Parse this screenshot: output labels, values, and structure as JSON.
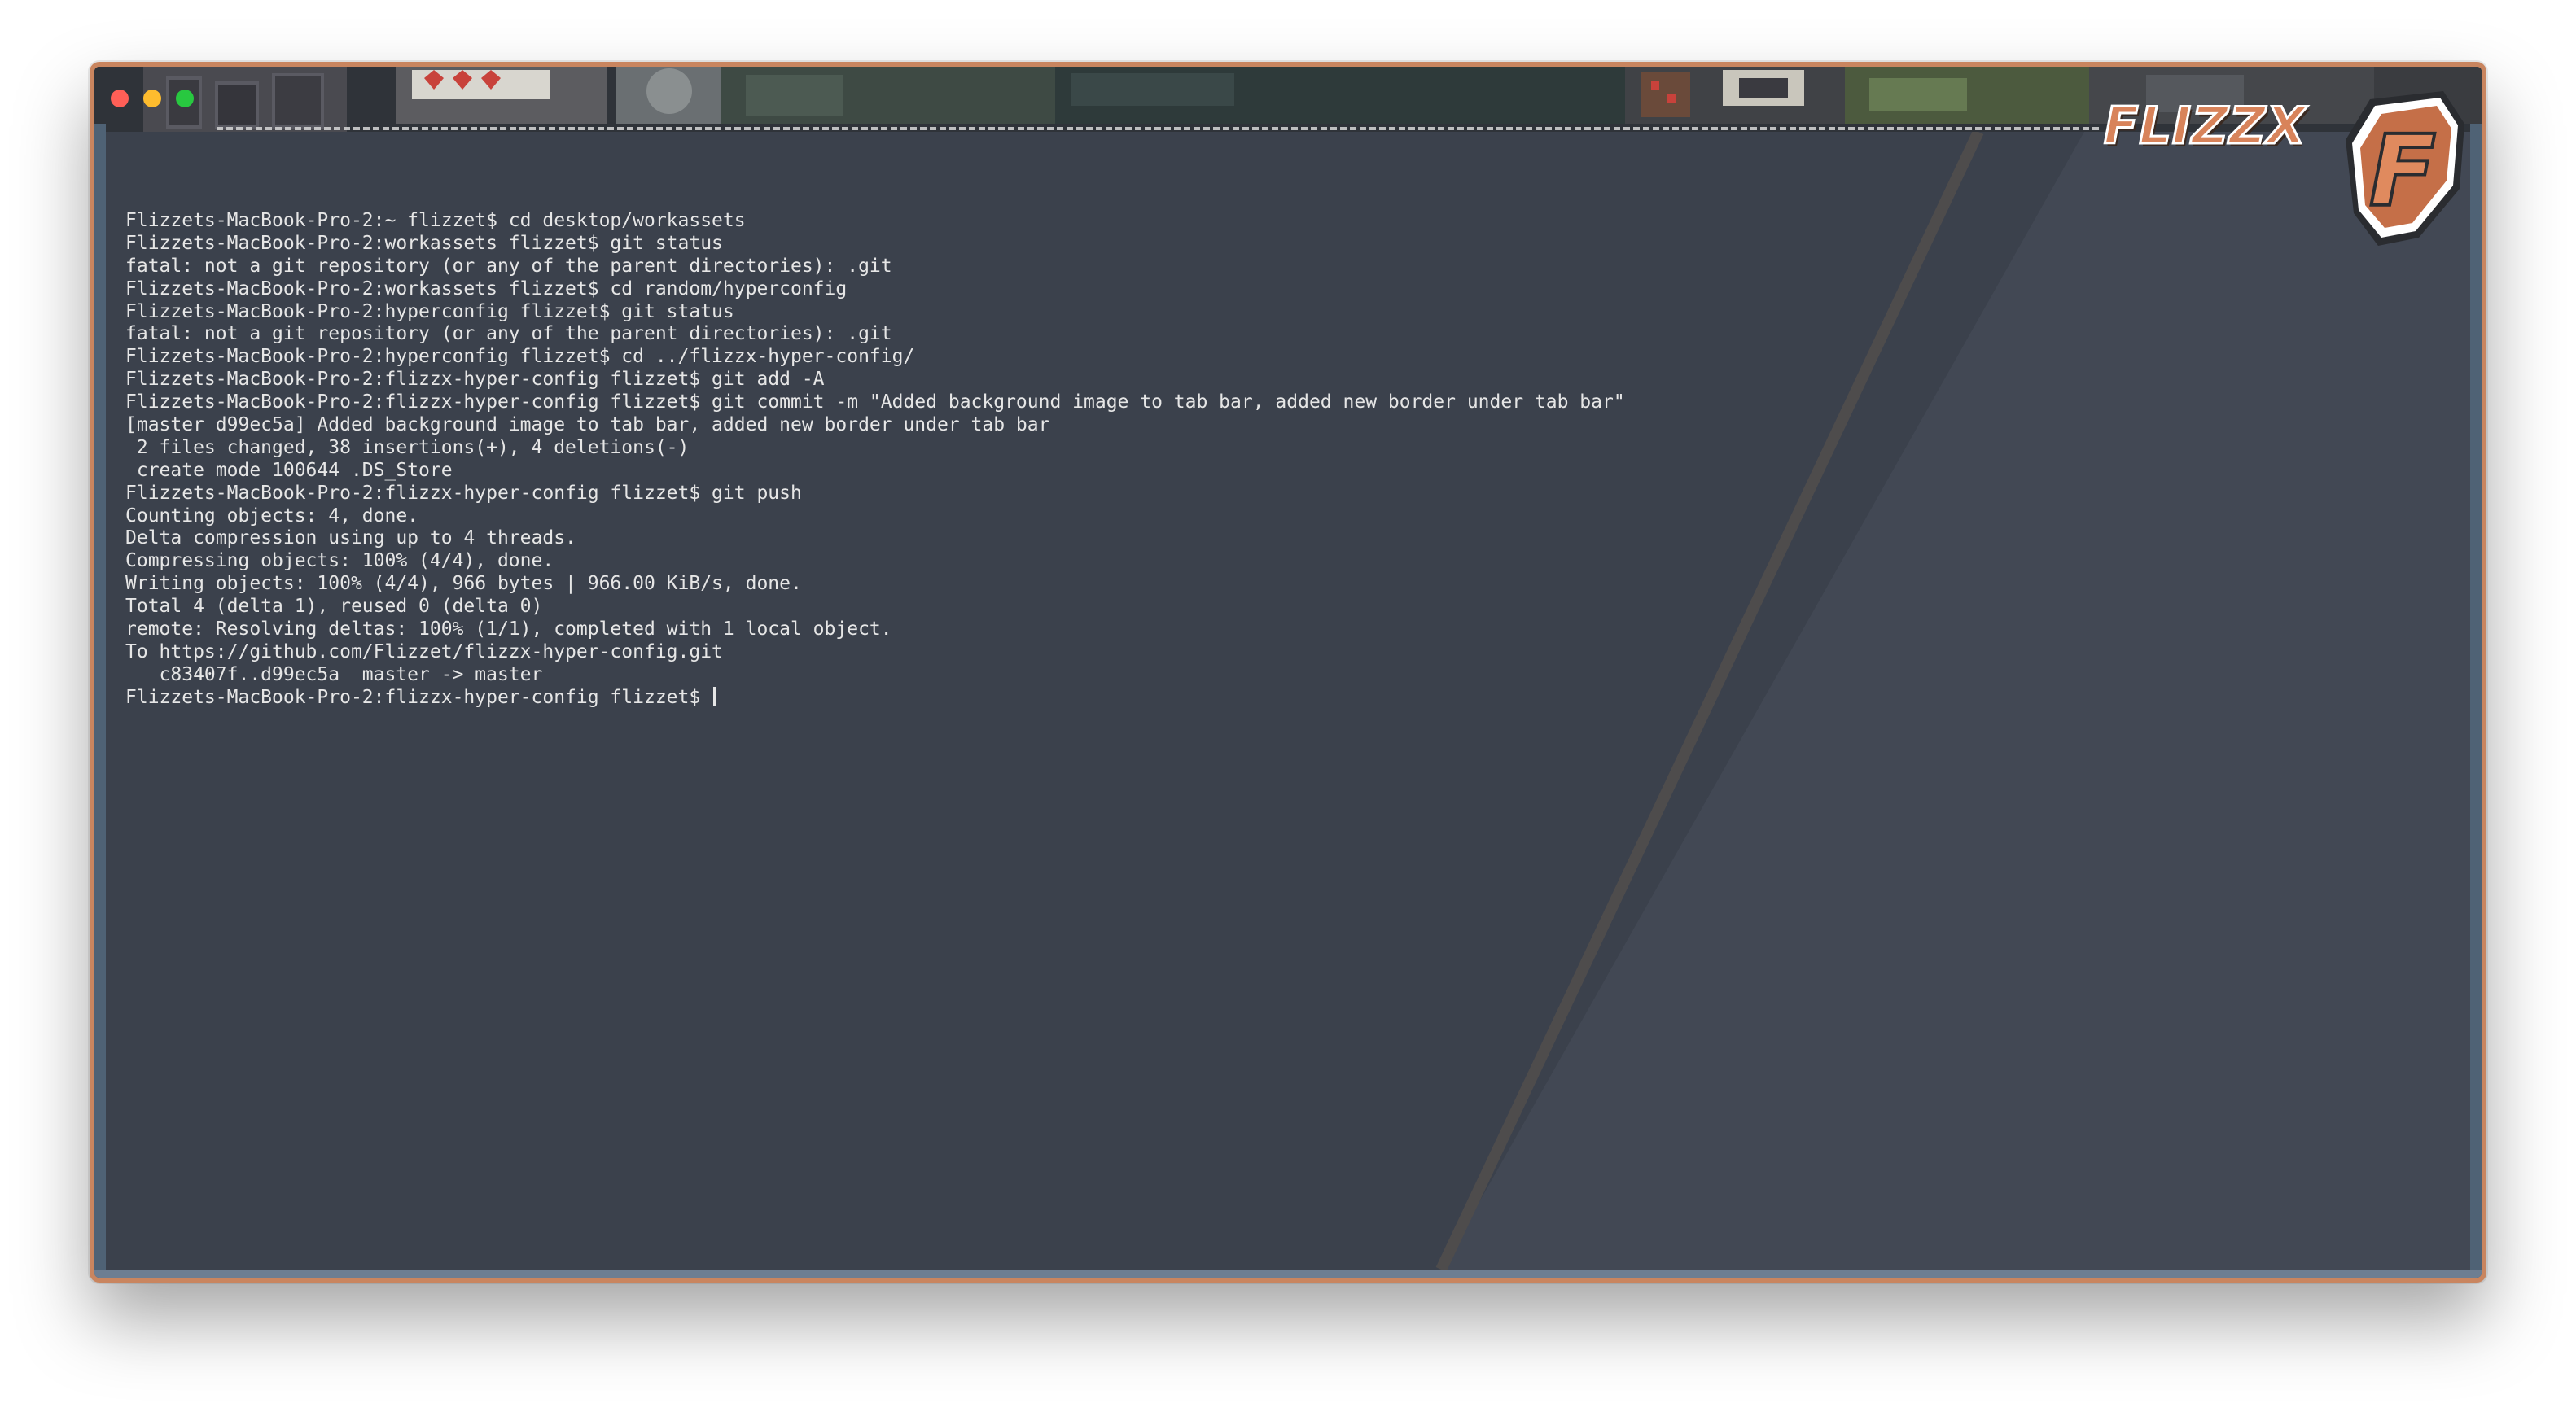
{
  "window": {
    "traffic_lights": [
      {
        "name": "close",
        "color": "#ff5f57"
      },
      {
        "name": "minimize",
        "color": "#febc2e"
      },
      {
        "name": "zoom",
        "color": "#28c840"
      }
    ],
    "accent_color": "#c9855f"
  },
  "logo": {
    "wordmark": "FLIZZX",
    "badge_letter": "F",
    "color": "#d8835a"
  },
  "terminal": {
    "lines": [
      "Flizzets-MacBook-Pro-2:~ flizzet$ cd desktop/workassets",
      "Flizzets-MacBook-Pro-2:workassets flizzet$ git status",
      "fatal: not a git repository (or any of the parent directories): .git",
      "Flizzets-MacBook-Pro-2:workassets flizzet$ cd random/hyperconfig",
      "Flizzets-MacBook-Pro-2:hyperconfig flizzet$ git status",
      "fatal: not a git repository (or any of the parent directories): .git",
      "Flizzets-MacBook-Pro-2:hyperconfig flizzet$ cd ../flizzx-hyper-config/",
      "Flizzets-MacBook-Pro-2:flizzx-hyper-config flizzet$ git add -A",
      "Flizzets-MacBook-Pro-2:flizzx-hyper-config flizzet$ git commit -m \"Added background image to tab bar, added new border under tab bar\"",
      "[master d99ec5a] Added background image to tab bar, added new border under tab bar",
      " 2 files changed, 38 insertions(+), 4 deletions(-)",
      " create mode 100644 .DS_Store",
      "Flizzets-MacBook-Pro-2:flizzx-hyper-config flizzet$ git push",
      "Counting objects: 4, done.",
      "Delta compression using up to 4 threads.",
      "Compressing objects: 100% (4/4), done.",
      "Writing objects: 100% (4/4), 966 bytes | 966.00 KiB/s, done.",
      "Total 4 (delta 1), reused 0 (delta 0)",
      "remote: Resolving deltas: 100% (1/1), completed with 1 local object.",
      "To https://github.com/Flizzet/flizzx-hyper-config.git",
      "   c83407f..d99ec5a  master -> master"
    ],
    "prompt": "Flizzets-MacBook-Pro-2:flizzx-hyper-config flizzet$ ",
    "text_color": "#e6e6e6",
    "background_color": "#3b414c"
  }
}
